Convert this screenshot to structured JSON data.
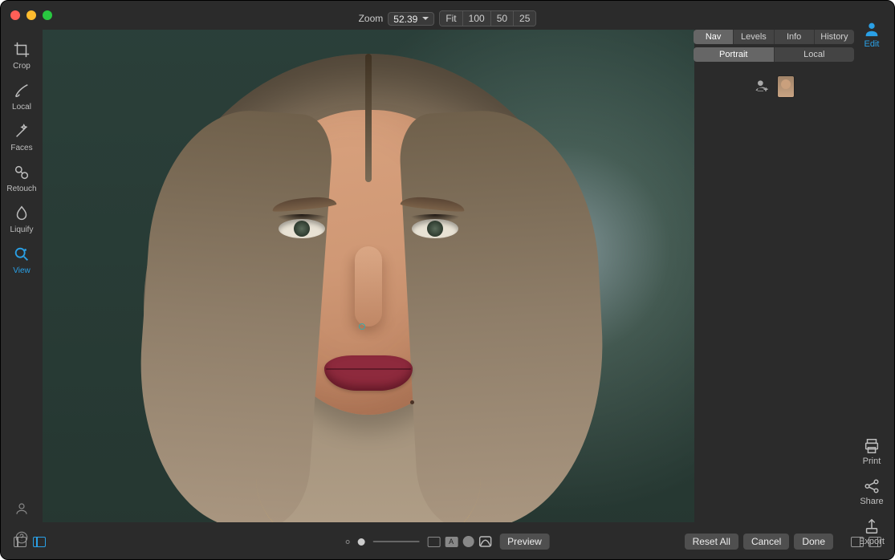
{
  "zoom": {
    "label": "Zoom",
    "value": "52.39",
    "presets": [
      "Fit",
      "100",
      "50",
      "25"
    ]
  },
  "tools": {
    "items": [
      {
        "id": "crop",
        "label": "Crop"
      },
      {
        "id": "local",
        "label": "Local"
      },
      {
        "id": "faces",
        "label": "Faces"
      },
      {
        "id": "retouch",
        "label": "Retouch"
      },
      {
        "id": "liquify",
        "label": "Liquify"
      },
      {
        "id": "view",
        "label": "View"
      }
    ],
    "active": "view"
  },
  "right_panel": {
    "tabs": [
      "Nav",
      "Levels",
      "Info",
      "History"
    ],
    "active_tab": "Nav",
    "subtabs": [
      "Portrait",
      "Local"
    ],
    "active_subtab": "Portrait"
  },
  "right_edge": {
    "top": {
      "label": "Edit"
    },
    "bottom": [
      {
        "id": "print",
        "label": "Print"
      },
      {
        "id": "share",
        "label": "Share"
      },
      {
        "id": "export",
        "label": "Export"
      }
    ]
  },
  "bottom": {
    "preview": "Preview",
    "actions": {
      "reset_all": "Reset All",
      "cancel": "Cancel",
      "done": "Done"
    }
  }
}
